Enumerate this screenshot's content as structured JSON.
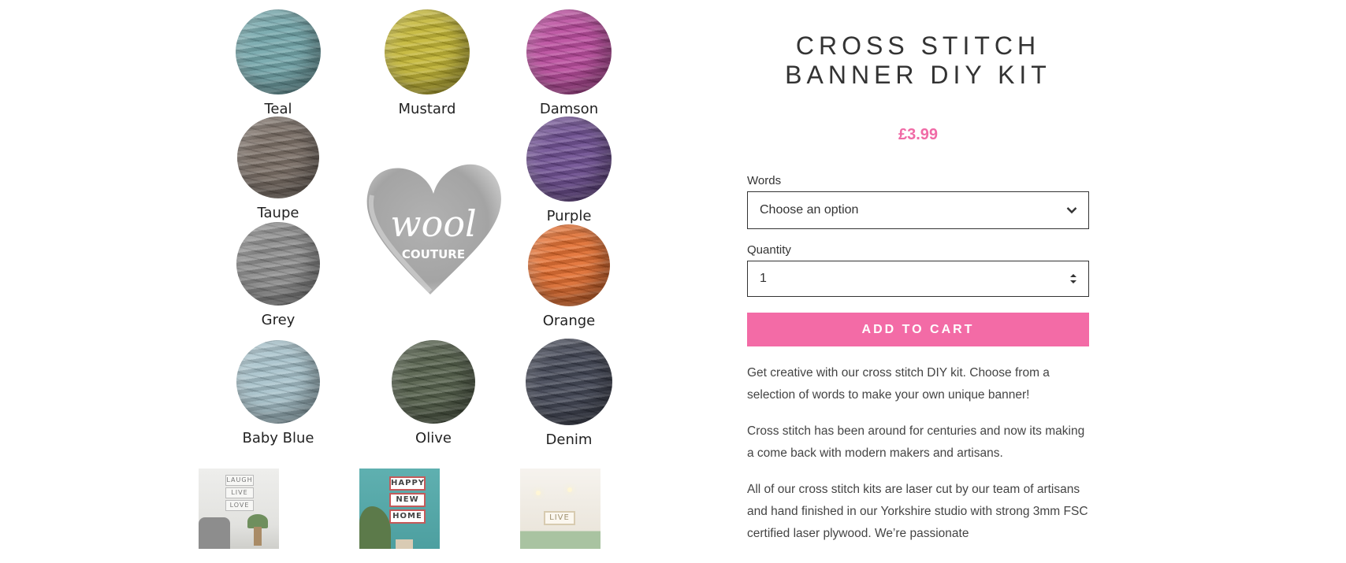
{
  "swatches": [
    {
      "label": "Teal",
      "color": "#6fa3a8"
    },
    {
      "label": "Mustard",
      "color": "#c2b430"
    },
    {
      "label": "Damson",
      "color": "#b7479a"
    },
    {
      "label": "Taupe",
      "color": "#766a61"
    },
    {
      "label": "Purple",
      "color": "#6a4a8e"
    },
    {
      "label": "Grey",
      "color": "#8a8a8a"
    },
    {
      "label": "Orange",
      "color": "#e26b2b"
    },
    {
      "label": "Baby Blue",
      "color": "#a4c0c9"
    },
    {
      "label": "Olive",
      "color": "#4f5b46"
    },
    {
      "label": "Denim",
      "color": "#3d4150"
    }
  ],
  "logo": {
    "text_1": "wool",
    "text_2": "COUTURE"
  },
  "thumbnails": {
    "t1": [
      "LAUGH",
      "LIVE",
      "LOVE"
    ],
    "t2": [
      "HAPPY",
      "NEW",
      "HOME"
    ],
    "t3": [
      "LIVE"
    ]
  },
  "product": {
    "title_line_1": "CROSS STITCH",
    "title_line_2": "BANNER DIY KIT",
    "price": "£3.99",
    "words_label": "Words",
    "words_value": "Choose an option",
    "quantity_label": "Quantity",
    "quantity_value": "1",
    "add_to_cart": "ADD TO CART",
    "description": [
      "Get creative with our cross stitch DIY kit.  Choose from a selection of words to make your own unique banner!",
      "Cross stitch has been around for centuries and now its making a come back with modern makers and artisans.",
      "All of our cross stitch kits are laser cut by our team of artisans and hand finished in our Yorkshire studio with strong 3mm FSC certified laser plywood. We’re passionate"
    ]
  },
  "colors": {
    "accent": "#f36ba6",
    "price": "#f06aa6",
    "text": "#333333"
  }
}
